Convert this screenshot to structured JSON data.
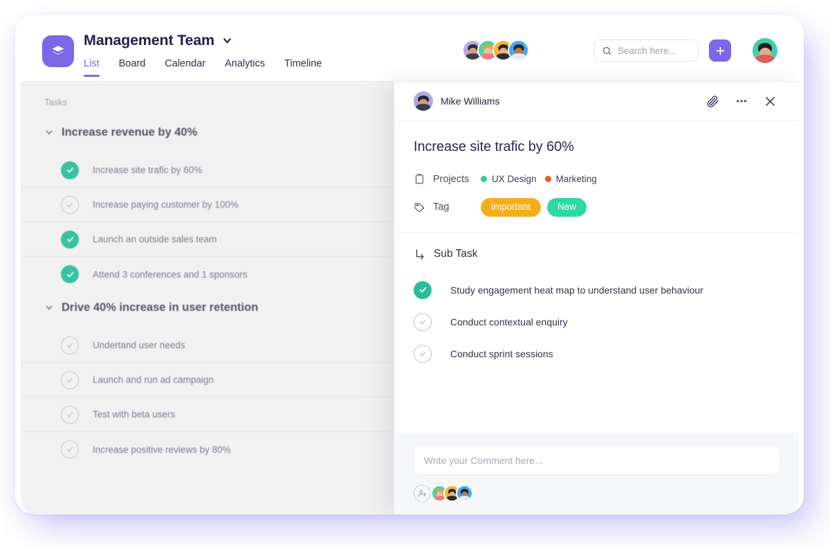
{
  "header": {
    "logo_icon": "layers-icon",
    "title": "Management Team",
    "title_chevron_icon": "chevron-down-icon",
    "tabs": [
      {
        "label": "List",
        "active": true
      },
      {
        "label": "Board",
        "active": false
      },
      {
        "label": "Calendar",
        "active": false
      },
      {
        "label": "Analytics",
        "active": false
      },
      {
        "label": "Timeline",
        "active": false
      }
    ],
    "member_avatars": [
      {
        "name": "member-avatar-1",
        "bg": "#b8a9e8",
        "hair": "#2f2b34",
        "skin": "#d89f77",
        "shirt": "#3c3f50"
      },
      {
        "name": "member-avatar-2",
        "bg": "#4ad6a4",
        "hair": "#e2a04a",
        "skin": "#f0c2a4",
        "shirt": "#f07c7c"
      },
      {
        "name": "member-avatar-3",
        "bg": "#f5b733",
        "hair": "#2b2522",
        "skin": "#e8b08d",
        "shirt": "#2e2b33"
      },
      {
        "name": "member-avatar-4",
        "bg": "#3fa9f5",
        "hair": "#2a2320",
        "skin": "#b5794f",
        "shirt": "#e9eaee"
      }
    ],
    "search": {
      "icon": "search-icon",
      "placeholder": "Search here...",
      "value": ""
    },
    "add_button": {
      "icon": "plus-icon",
      "label": "+"
    },
    "profile_avatar": {
      "name": "profile-avatar",
      "bg": "#3fd0ae",
      "hair": "#251c22",
      "skin": "#e3ab86",
      "shirt": "#e05b5b"
    }
  },
  "task_pane": {
    "section_label": "Tasks",
    "groups": [
      {
        "title": "Increase revenue by 40%",
        "chevron_icon": "chevron-down-icon",
        "tasks": [
          {
            "label": "Increase site trafic by 60%",
            "done": true
          },
          {
            "label": "Increase paying customer by 100%",
            "done": false
          },
          {
            "label": "Launch an outside sales team",
            "done": true
          },
          {
            "label": "Attend 3 conferences and 1 sponsors",
            "done": true
          }
        ]
      },
      {
        "title": "Drive 40% increase in user retention",
        "chevron_icon": "chevron-down-icon",
        "tasks": [
          {
            "label": "Undertand user needs",
            "done": false
          },
          {
            "label": "Launch and run ad campaign",
            "done": false
          },
          {
            "label": "Test with beta users",
            "done": false
          },
          {
            "label": "Increase positive reviews by 80%",
            "done": false
          }
        ]
      }
    ]
  },
  "detail_panel": {
    "user": {
      "avatar_name": "detail-user-avatar",
      "name": "Mike Williams",
      "bg": "#b3a6e3",
      "hair": "#2c2730",
      "skin": "#d49c73",
      "shirt": "#3a3d4c"
    },
    "actions": [
      {
        "name": "attachment-button",
        "icon": "paperclip-icon"
      },
      {
        "name": "more-options-button",
        "icon": "ellipsis-icon"
      },
      {
        "name": "close-panel-button",
        "icon": "close-icon"
      }
    ],
    "title": "Increase site trafic by 60%",
    "projects": {
      "icon": "clipboard-icon",
      "label": "Projects",
      "items": [
        {
          "label": "UX Design",
          "color": "#2ecf9b"
        },
        {
          "label": "Marketing",
          "color": "#f0572d"
        }
      ]
    },
    "tag": {
      "icon": "tag-icon",
      "label": "Tag",
      "items": [
        {
          "label": "Important",
          "color": "#f5ae1b"
        },
        {
          "label": "New",
          "color": "#2ed9a5"
        }
      ]
    },
    "subtask": {
      "icon": "subtask-branch-icon",
      "label": "Sub Task",
      "items": [
        {
          "label": "Study engagement heat map to understand user behaviour",
          "done": true
        },
        {
          "label": "Conduct contextual enquiry",
          "done": false
        },
        {
          "label": "Conduct sprint sessions",
          "done": false
        }
      ]
    },
    "comment": {
      "placeholder": "Write your Comment here...",
      "value": "",
      "add_person_icon": "add-person-icon",
      "assignees": [
        {
          "name": "assignee-avatar-1",
          "bg": "#4ad6a4",
          "hair": "#e2a04a",
          "skin": "#f0c2a4",
          "shirt": "#f07c7c"
        },
        {
          "name": "assignee-avatar-2",
          "bg": "#f5b733",
          "hair": "#2b2522",
          "skin": "#e8b08d",
          "shirt": "#2e2b33"
        },
        {
          "name": "assignee-avatar-3",
          "bg": "#3fa9f5",
          "hair": "#2a2320",
          "skin": "#b5794f",
          "shirt": "#e9eaee"
        }
      ]
    }
  },
  "colors": {
    "accent": "#7b68e8",
    "done_green": "#29bd9c",
    "panel_bg": "#f0f0f1",
    "footer_bg": "#f6f7f9"
  }
}
